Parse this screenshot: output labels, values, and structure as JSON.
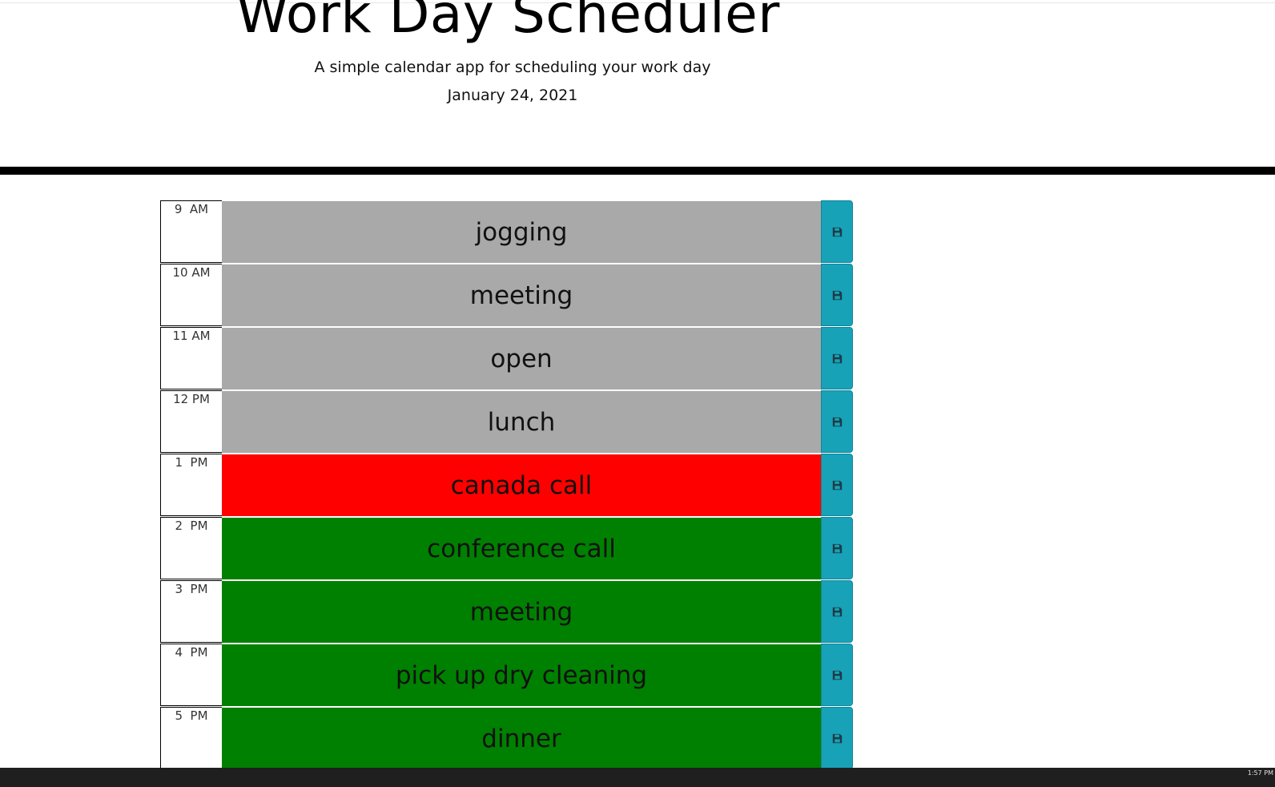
{
  "header": {
    "title": "Work Day Scheduler",
    "subtitle": "A simple calendar app for scheduling your work day",
    "current_day": "January 24, 2021"
  },
  "colors": {
    "past": "#a9a9a9",
    "present": "#ff0000",
    "future": "#008000",
    "save_button": "#17a2b8"
  },
  "schedule": [
    {
      "hour": "9  AM",
      "text": "jogging",
      "status": "past",
      "icon": "save-icon"
    },
    {
      "hour": "10 AM",
      "text": "meeting",
      "status": "past",
      "icon": "save-icon"
    },
    {
      "hour": "11 AM",
      "text": "open",
      "status": "past",
      "icon": "save-icon"
    },
    {
      "hour": "12 PM",
      "text": "lunch",
      "status": "past",
      "icon": "save-icon"
    },
    {
      "hour": "1  PM",
      "text": "canada call",
      "status": "present",
      "icon": "save-icon"
    },
    {
      "hour": "2  PM",
      "text": "conference call",
      "status": "future",
      "icon": "save-icon"
    },
    {
      "hour": "3  PM",
      "text": "meeting",
      "status": "future",
      "icon": "save-icon"
    },
    {
      "hour": "4  PM",
      "text": "pick up dry cleaning",
      "status": "future",
      "icon": "save-icon"
    },
    {
      "hour": "5  PM",
      "text": "dinner",
      "status": "future",
      "icon": "save-icon"
    }
  ],
  "taskbar": {
    "clock": "1:57 PM"
  }
}
